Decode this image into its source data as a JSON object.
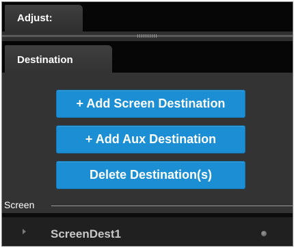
{
  "tabs": {
    "top": {
      "label": "Adjust:"
    },
    "second": {
      "label": "Destination"
    }
  },
  "buttons": {
    "add_screen": "+ Add Screen Destination",
    "add_aux": "+ Add Aux Destination",
    "delete": "Delete Destination(s)"
  },
  "group": {
    "label": "Screen"
  },
  "list": {
    "items": [
      {
        "label": "ScreenDest1"
      }
    ]
  },
  "colors": {
    "accent": "#1b8ed4",
    "panel": "#333333",
    "background": "#0b0b0b"
  }
}
